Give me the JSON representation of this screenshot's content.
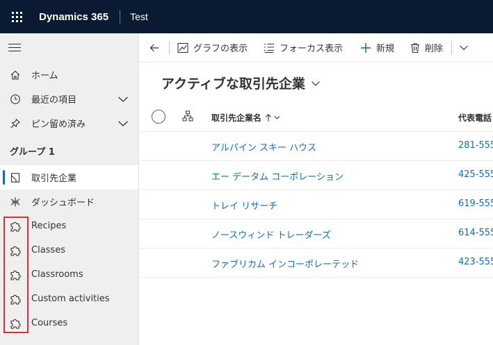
{
  "topbar": {
    "app_name": "Dynamics 365",
    "environment": "Test"
  },
  "sidebar": {
    "home": "ホーム",
    "recent": "最近の項目",
    "pinned": "ピン留め済み",
    "group_title": "グループ 1",
    "items": [
      {
        "label": "取引先企業",
        "icon": "account-icon",
        "selected": true
      },
      {
        "label": "ダッシュボード",
        "icon": "dashboard-icon"
      },
      {
        "label": "Recipes",
        "icon": "puzzle-icon"
      },
      {
        "label": "Classes",
        "icon": "puzzle-icon"
      },
      {
        "label": "Classrooms",
        "icon": "puzzle-icon"
      },
      {
        "label": "Custom activities",
        "icon": "puzzle-icon"
      },
      {
        "label": "Courses",
        "icon": "puzzle-icon"
      }
    ],
    "highlight_color": "#d13438"
  },
  "commandbar": {
    "show_chart": "グラフの表示",
    "focused_view": "フォーカス表示",
    "new": "新規",
    "delete": "削除"
  },
  "view": {
    "title": "アクティブな取引先企業",
    "columns": {
      "name": "取引先企業名",
      "phone": "代表電話"
    },
    "rows": [
      {
        "name": "アルパイン スキー ハウス",
        "phone": "281-555"
      },
      {
        "name": "エー データム コーポレーション",
        "phone": "425-555"
      },
      {
        "name": "トレイ リサーチ",
        "phone": "619-555"
      },
      {
        "name": "ノースウィンド トレーダーズ",
        "phone": "614-555"
      },
      {
        "name": "ファブリカム インコーポレーテッド",
        "phone": "423-555"
      }
    ]
  },
  "colors": {
    "header_bg": "#0b1a33",
    "link": "#0f6cbd",
    "accent": "#0f6cbd",
    "new_icon": "#107c10"
  }
}
